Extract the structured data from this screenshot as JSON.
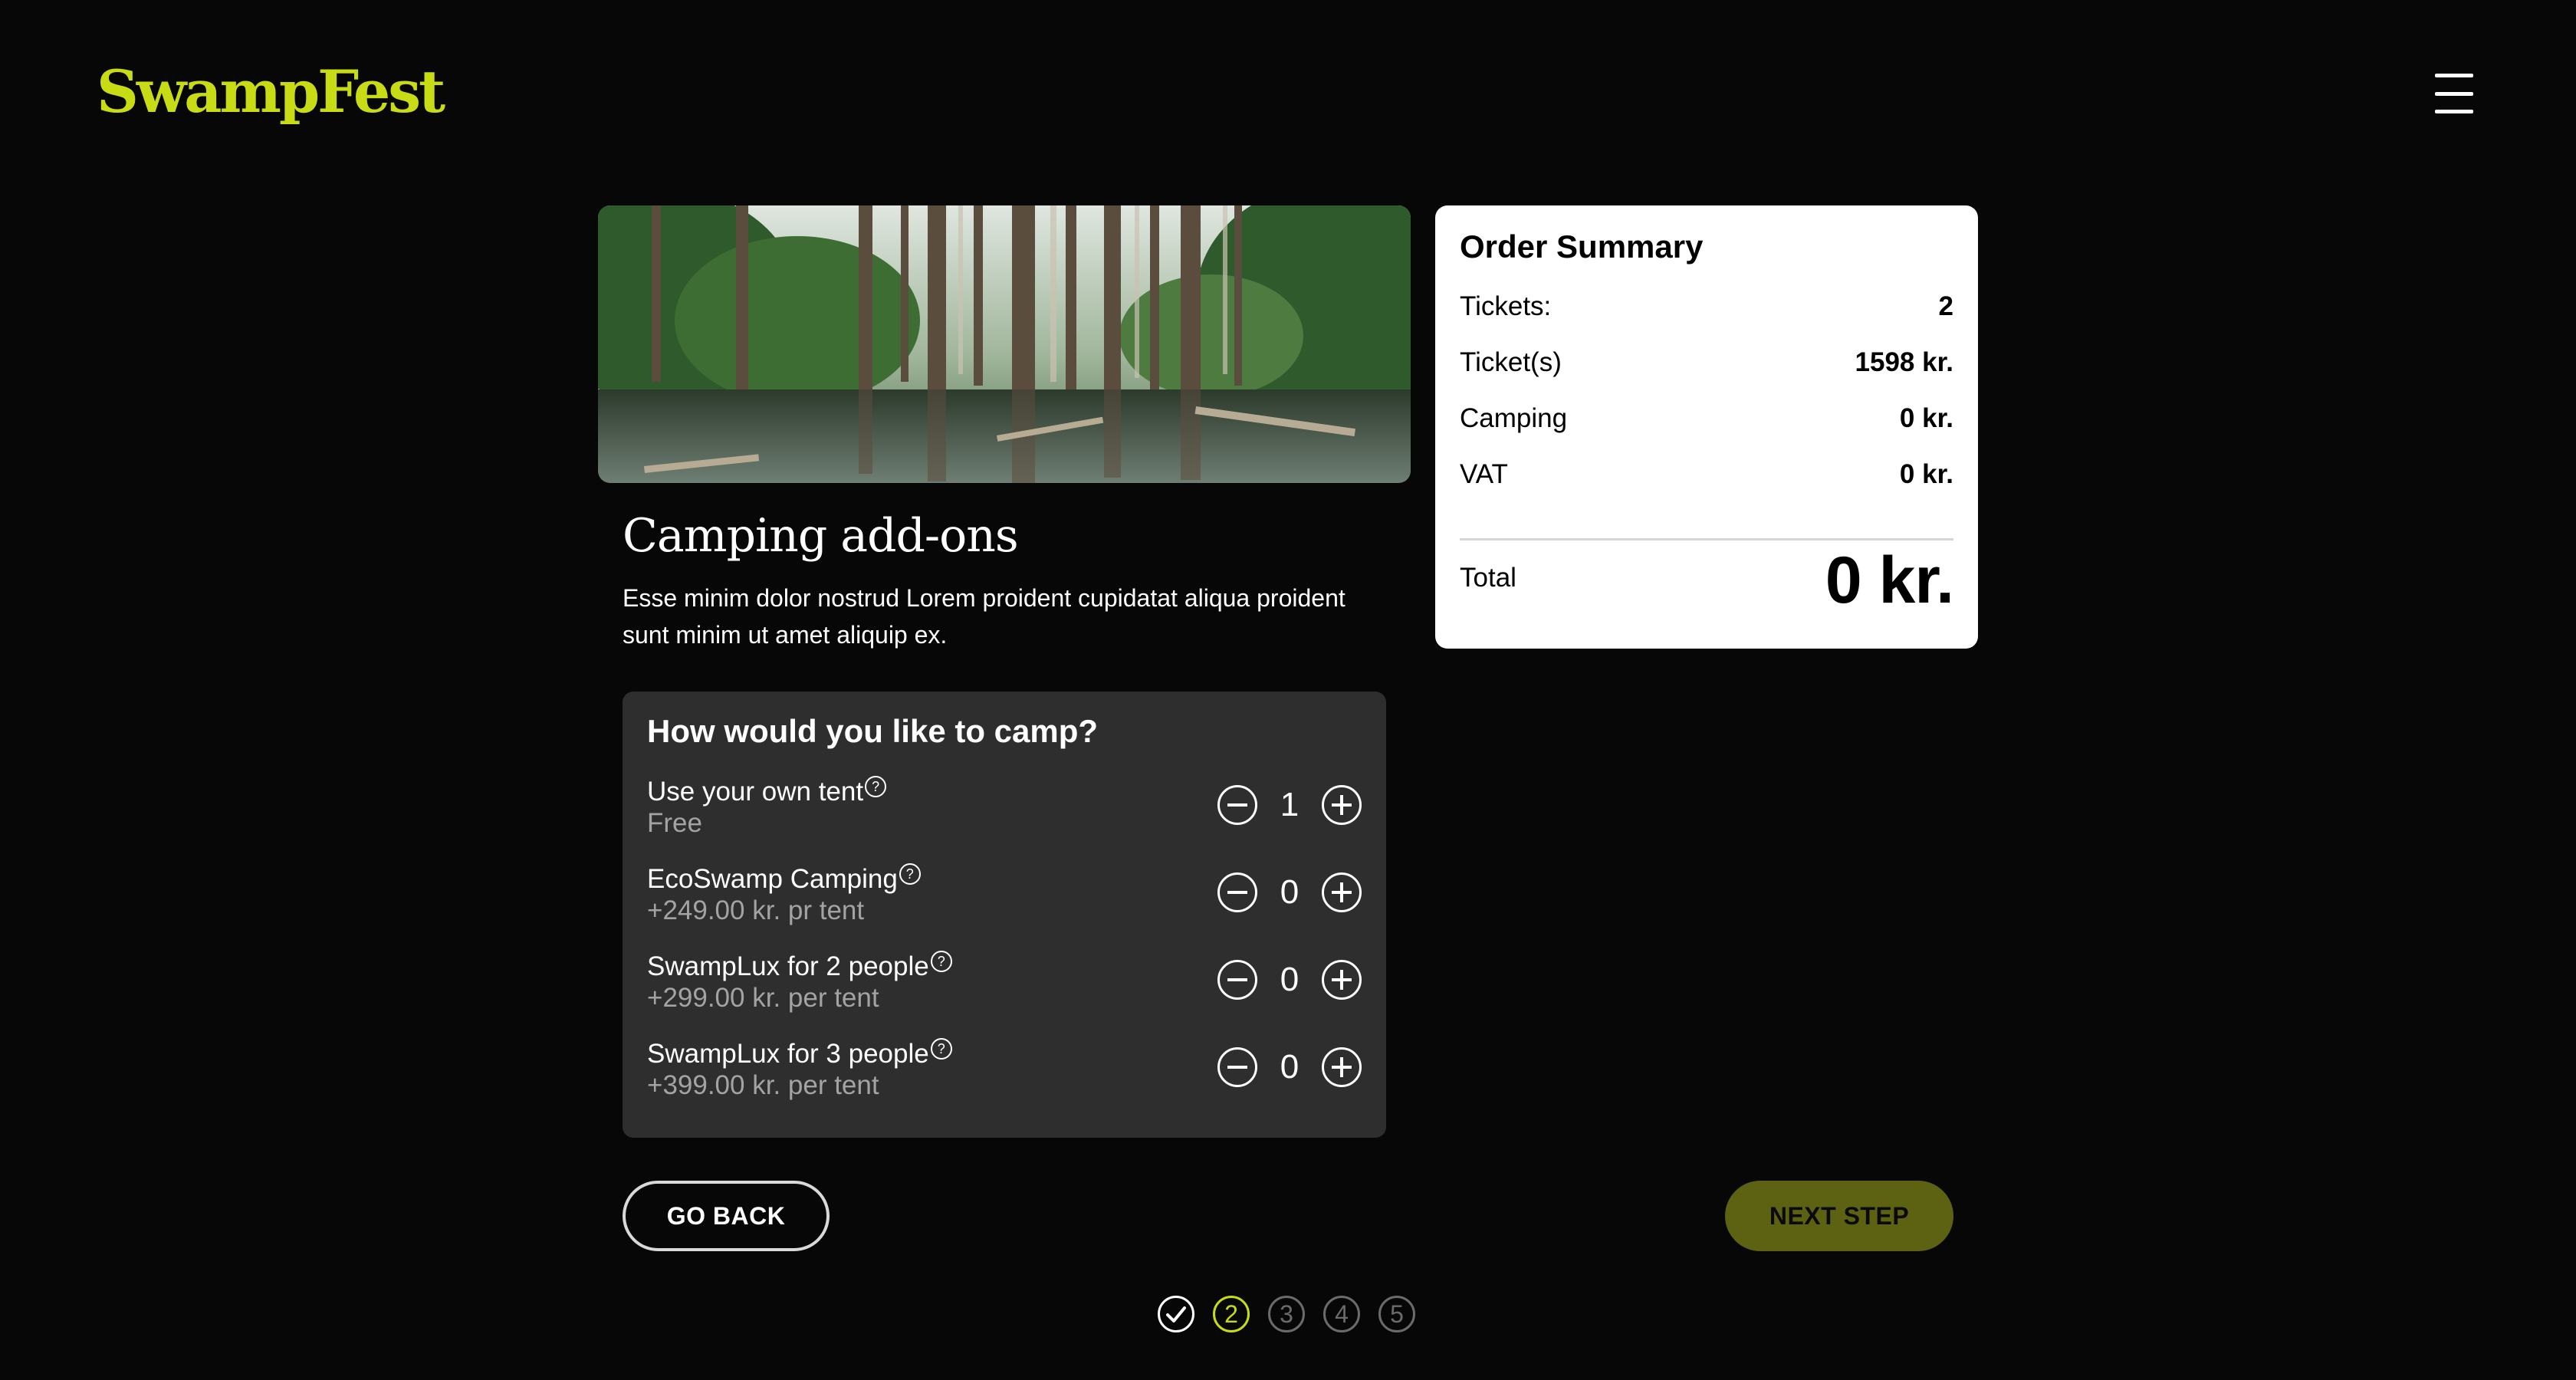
{
  "header": {
    "logo_text": "SwampFest",
    "menu_icon": "hamburger-menu-icon"
  },
  "theme": {
    "accent": "#c8dc16",
    "background": "#070707",
    "panel": "#2e2e2e",
    "next_button_bg": "#5d6112"
  },
  "hero": {
    "image": "swamp-forest-photo"
  },
  "section": {
    "title": "Camping add-ons",
    "description": "Esse minim dolor nostrud Lorem proident cupidatat aliqua proident sunt minim ut amet aliquip ex."
  },
  "camping": {
    "title": "How would you like to camp?",
    "options": [
      {
        "name": "Use your own tent",
        "price": "Free",
        "quantity": 1
      },
      {
        "name": "EcoSwamp Camping",
        "price": "+249.00 kr. pr tent",
        "quantity": 0
      },
      {
        "name": "SwampLux for 2 people",
        "price": "+299.00 kr. per tent",
        "quantity": 0
      },
      {
        "name": "SwampLux for 3 people",
        "price": "+399.00 kr. per tent",
        "quantity": 0
      }
    ],
    "help_symbol": "?"
  },
  "navigation": {
    "back_label": "GO BACK",
    "next_label": "NEXT STEP"
  },
  "progress": {
    "steps": [
      "1",
      "2",
      "3",
      "4",
      "5"
    ],
    "current": 2,
    "completed": [
      1
    ]
  },
  "summary": {
    "title": "Order Summary",
    "rows": [
      {
        "label": "Tickets:",
        "value": "2"
      },
      {
        "label": "Ticket(s)",
        "value": "1598 kr."
      },
      {
        "label": "Camping",
        "value": "0 kr."
      },
      {
        "label": "VAT",
        "value": "0 kr."
      }
    ],
    "total_label": "Total",
    "total_value": "0 kr."
  }
}
